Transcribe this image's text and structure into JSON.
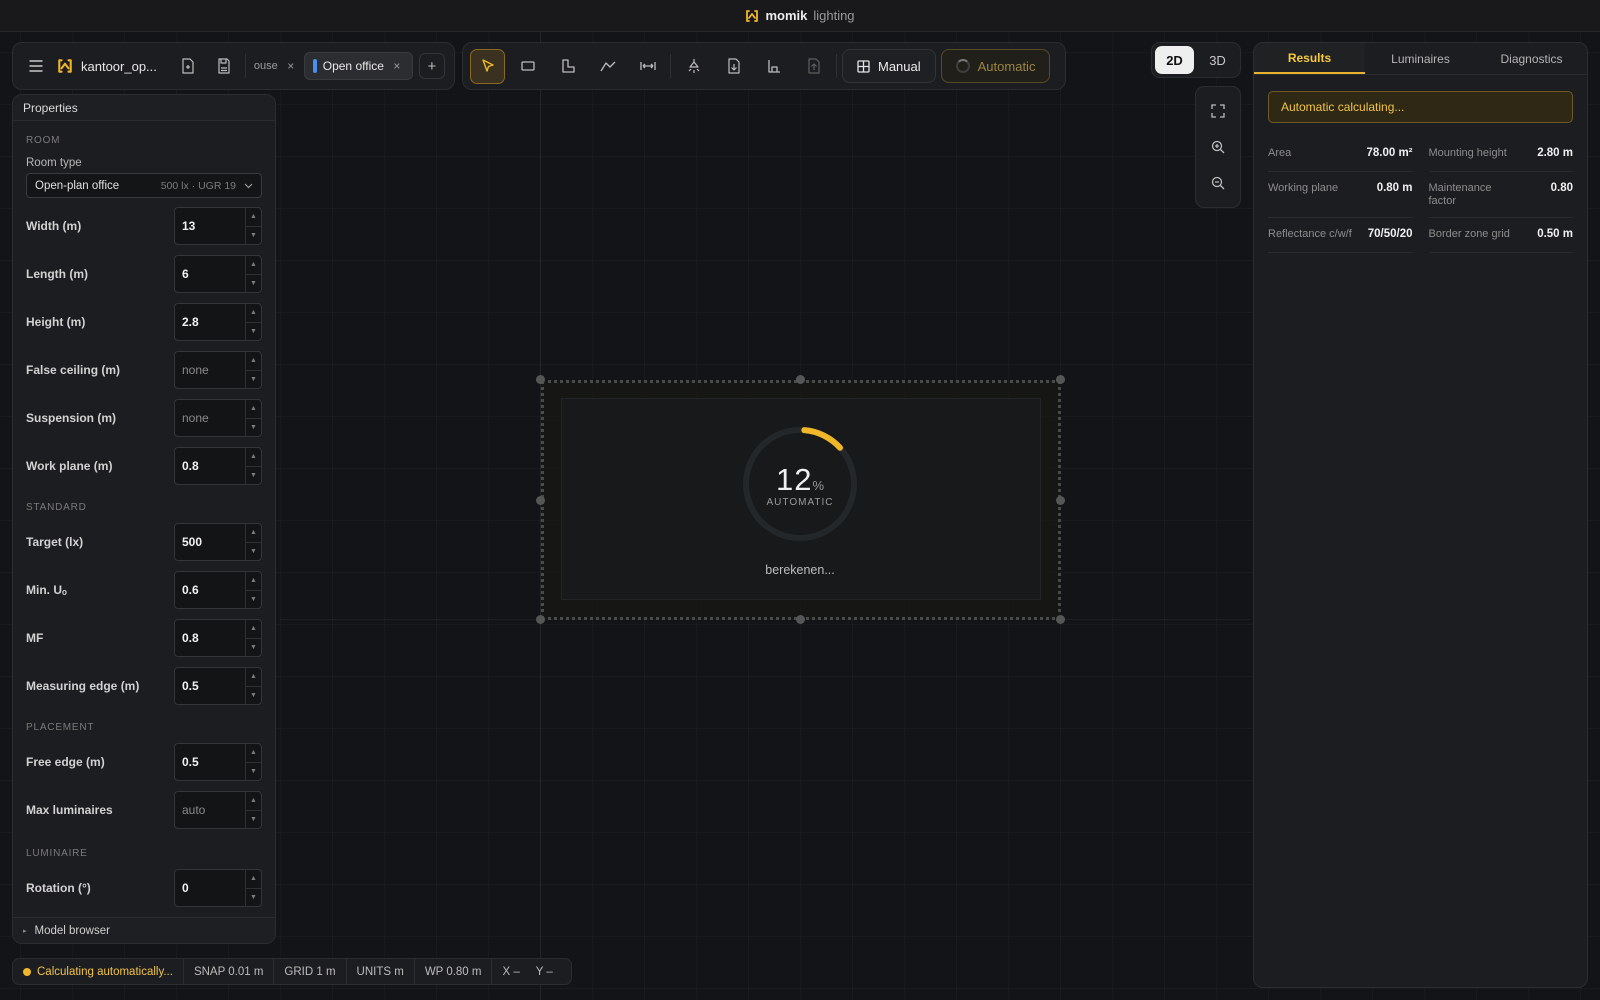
{
  "app": {
    "brand_name": "momik",
    "brand_sub": "lighting"
  },
  "project": {
    "name": "kantoor_op...",
    "tabs": [
      {
        "label": "ouse"
      },
      {
        "label": "Open office",
        "color": "#4a8ef0"
      }
    ]
  },
  "toolbar": {
    "manual_label": "Manual",
    "automatic_label": "Automatic"
  },
  "view": {
    "options": [
      "2D",
      "3D"
    ],
    "selected": "2D"
  },
  "properties": {
    "title": "Properties",
    "sections": {
      "room": "ROOM",
      "standard": "STANDARD",
      "placement": "PLACEMENT",
      "luminaire": "LUMINAIRE"
    },
    "room_type_label": "Room type",
    "room_type_value": "Open-plan office",
    "room_type_hint": "500 lx · UGR 19",
    "room_fields": [
      {
        "label": "Width (m)",
        "value": "13"
      },
      {
        "label": "Length (m)",
        "value": "6"
      },
      {
        "label": "Height (m)",
        "value": "2.8"
      },
      {
        "label": "False ceiling (m)",
        "value": "none"
      },
      {
        "label": "Suspension (m)",
        "value": "none"
      },
      {
        "label": "Work plane (m)",
        "value": "0.8"
      }
    ],
    "standard_fields": [
      {
        "label": "Target (lx)",
        "value": "500"
      },
      {
        "label": "Min. Uₒ",
        "value": "0.6"
      },
      {
        "label": "MF",
        "value": "0.8"
      },
      {
        "label": "Measuring edge (m)",
        "value": "0.5"
      }
    ],
    "placement_fields": [
      {
        "label": "Free edge (m)",
        "value": "0.5"
      },
      {
        "label": "Max luminaires",
        "value": "auto"
      }
    ],
    "luminaire_fields": [
      {
        "label": "Rotation (°)",
        "value": "0"
      }
    ],
    "model_browser": "Model browser"
  },
  "progress": {
    "percent": 12,
    "number": "12",
    "unit": "%",
    "caption": "AUTOMATIC",
    "text": "berekenen..."
  },
  "results": {
    "tabs": [
      "Results",
      "Luminaires",
      "Diagnostics"
    ],
    "active_tab": "Results",
    "alert": "Automatic calculating...",
    "stats": [
      {
        "label": "Area",
        "value": "78.00 m²"
      },
      {
        "label": "Mounting height",
        "value": "2.80 m"
      },
      {
        "label": "Working plane",
        "value": "0.80 m"
      },
      {
        "label": "Maintenance factor",
        "value": "0.80"
      },
      {
        "label": "Reflectance c/w/f",
        "value": "70/50/20"
      },
      {
        "label": "Border zone grid",
        "value": "0.50 m"
      }
    ]
  },
  "status": {
    "message": "Calculating automatically...",
    "snap": "SNAP 0.01 m",
    "grid": "GRID 1 m",
    "units": "UNITS m",
    "wp": "WP 0.80 m",
    "x": "X –",
    "y": "Y –"
  },
  "colors": {
    "accent": "#f0b729",
    "tab_marker": "#4a8ef0"
  }
}
